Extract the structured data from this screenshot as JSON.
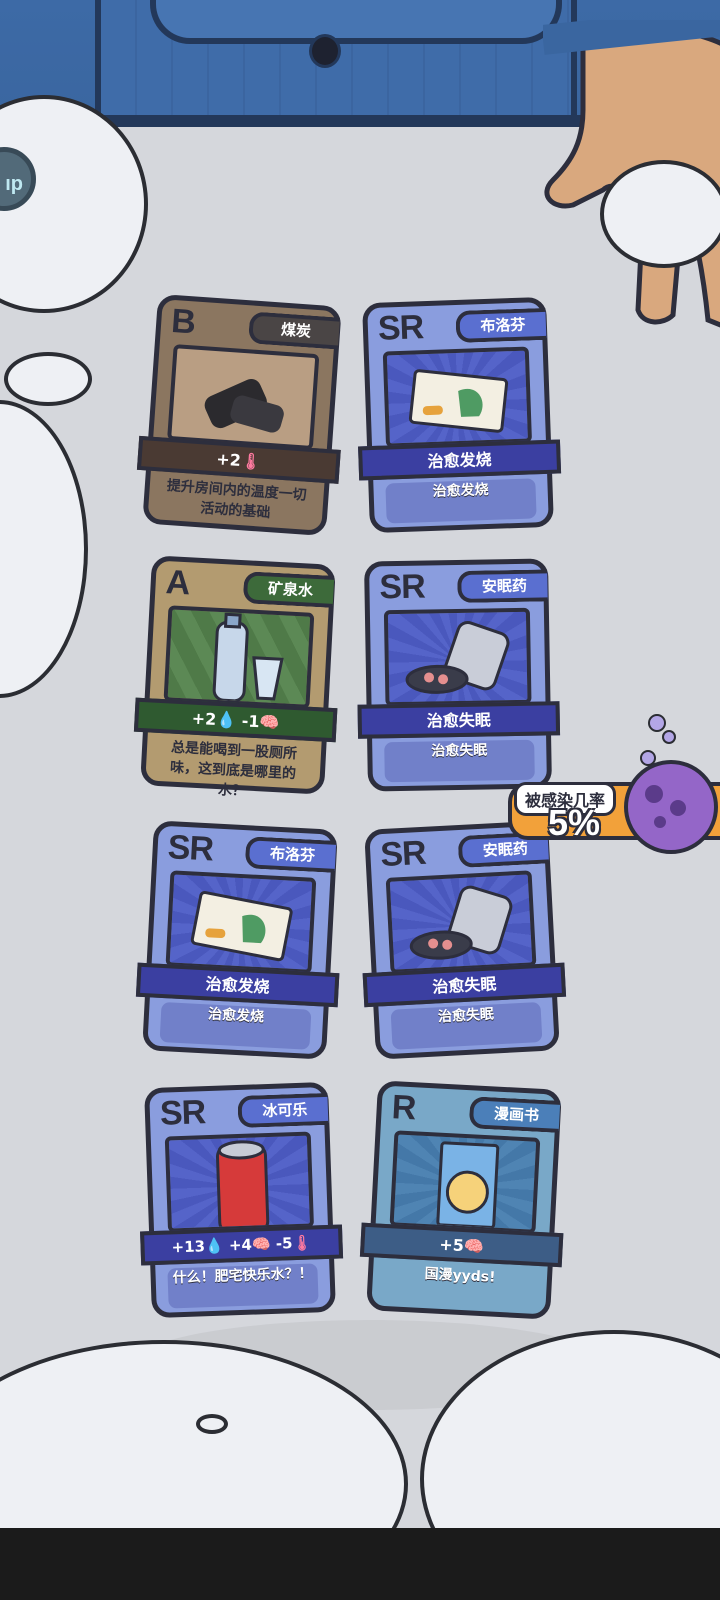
{
  "side_button": {
    "label": "ıp"
  },
  "cards": [
    {
      "grade": "B",
      "name": "煤炭",
      "stats": [
        {
          "text": "+2",
          "icon": "thermometer-icon"
        }
      ],
      "desc": "提升房间内的温度一切活动的基础"
    },
    {
      "grade": "SR",
      "name": "布洛芬",
      "effect": "治愈发烧",
      "desc": "治愈发烧"
    },
    {
      "grade": "A",
      "name": "矿泉水",
      "stats": [
        {
          "text": "+2",
          "icon": "water-drop-icon"
        },
        {
          "text": "-1",
          "icon": "brain-icon"
        }
      ],
      "desc": "总是能喝到一股厕所味，这到底是哪里的水？"
    },
    {
      "grade": "SR",
      "name": "安眠药",
      "effect": "治愈失眠",
      "desc": "治愈失眠"
    },
    {
      "grade": "SR",
      "name": "布洛芬",
      "effect": "治愈发烧",
      "desc": "治愈发烧"
    },
    {
      "grade": "SR",
      "name": "安眠药",
      "effect": "治愈失眠",
      "desc": "治愈失眠"
    },
    {
      "grade": "SR",
      "name": "冰可乐",
      "stats": [
        {
          "text": "+13",
          "icon": "water-drop-icon"
        },
        {
          "text": "+4",
          "icon": "brain-icon"
        },
        {
          "text": "-5",
          "icon": "thermometer-icon"
        }
      ],
      "desc": "什么！肥宅快乐水？！"
    },
    {
      "grade": "R",
      "name": "漫画书",
      "stats": [
        {
          "text": "+5",
          "icon": "brain-icon"
        }
      ],
      "desc": "国漫yyds!"
    }
  ],
  "infection": {
    "label": "被感染几率",
    "value": "5%"
  },
  "colors": {
    "sr_card": "#8a9dde",
    "b_card": "#8b7660",
    "a_card": "#b39b70",
    "r_card": "#79a8c8",
    "infection_badge": "#f2a13a",
    "virus": "#9466c8"
  }
}
